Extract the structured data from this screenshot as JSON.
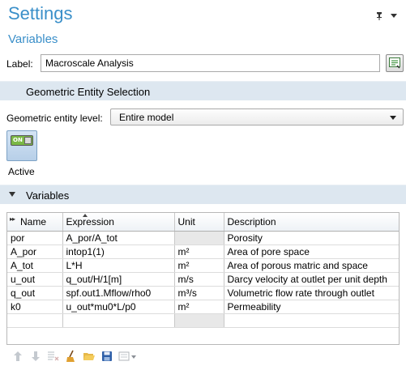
{
  "header": {
    "title": "Settings",
    "subtitle": "Variables"
  },
  "label_field": {
    "label": "Label:",
    "value": "Macroscale Analysis"
  },
  "geometric_section": {
    "title": "Geometric Entity Selection"
  },
  "geometric_level": {
    "label": "Geometric entity level:",
    "value": "Entire model"
  },
  "active": {
    "toggle_text": "ON",
    "label": "Active"
  },
  "variables_section": {
    "title": "Variables"
  },
  "table": {
    "columns": [
      "Name",
      "Expression",
      "Unit",
      "Description"
    ],
    "rows": [
      {
        "name": "por",
        "expression": "A_por/A_tot",
        "unit": "",
        "description": "Porosity"
      },
      {
        "name": "A_por",
        "expression": "intop1(1)",
        "unit": "m²",
        "description": "Area of pore space"
      },
      {
        "name": "A_tot",
        "expression": "L*H",
        "unit": "m²",
        "description": "Area of porous matric and space"
      },
      {
        "name": "u_out",
        "expression": "q_out/H/1[m]",
        "unit": "m/s",
        "description": "Darcy velocity at outlet per unit depth"
      },
      {
        "name": "q_out",
        "expression": "spf.out1.Mflow/rho0",
        "unit": "m³/s",
        "description": "Volumetric flow rate through outlet"
      },
      {
        "name": "k0",
        "expression": "u_out*mu0*L/p0",
        "unit": "m²",
        "description": "Permeability"
      },
      {
        "name": "",
        "expression": "",
        "unit": "",
        "description": ""
      }
    ]
  },
  "toolbar": {
    "icons": [
      "move-up-icon",
      "move-down-icon",
      "delete-icon",
      "clear-table-icon",
      "load-from-file-icon",
      "save-to-file-icon",
      "more-options-icon"
    ]
  }
}
